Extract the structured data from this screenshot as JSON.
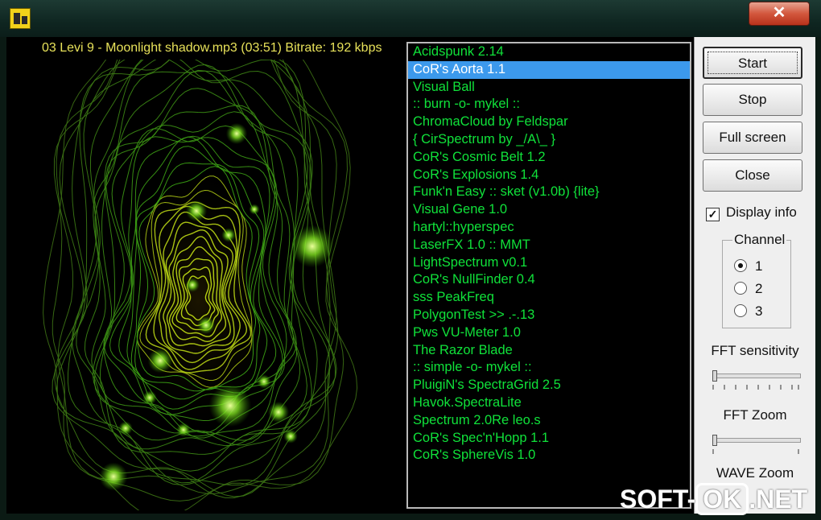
{
  "window": {
    "close_glyph": "✕"
  },
  "info_text": "03 Levi 9 - Moonlight shadow.mp3 (03:51) Bitrate: 192 kbps",
  "plugins": [
    {
      "label": "Acidspunk 2.14",
      "selected": false
    },
    {
      "label": "CoR's Aorta 1.1",
      "selected": true
    },
    {
      "label": "Visual Ball",
      "selected": false
    },
    {
      "label": ":: burn -o- mykel ::",
      "selected": false
    },
    {
      "label": "ChromaCloud by Feldspar",
      "selected": false
    },
    {
      "label": "{ CirSpectrum by _/A\\_ }",
      "selected": false
    },
    {
      "label": "CoR's Cosmic Belt 1.2",
      "selected": false
    },
    {
      "label": "CoR's Explosions 1.4",
      "selected": false
    },
    {
      "label": "Funk'n Easy :: sket (v1.0b) {lite}",
      "selected": false
    },
    {
      "label": "Visual Gene 1.0",
      "selected": false
    },
    {
      "label": "hartyl::hyperspec",
      "selected": false
    },
    {
      "label": "LaserFX 1.0 :: MMT",
      "selected": false
    },
    {
      "label": "LightSpectrum v0.1",
      "selected": false
    },
    {
      "label": "CoR's NullFinder 0.4",
      "selected": false
    },
    {
      "label": "sss PeakFreq",
      "selected": false
    },
    {
      "label": "PolygonTest >> .-.13",
      "selected": false
    },
    {
      "label": "Pws VU-Meter 1.0",
      "selected": false
    },
    {
      "label": "The Razor Blade",
      "selected": false
    },
    {
      "label": ":: simple -o- mykel ::",
      "selected": false
    },
    {
      "label": "PluigiN's SpectraGrid 2.5",
      "selected": false
    },
    {
      "label": "Havok.SpectraLite",
      "selected": false
    },
    {
      "label": "Spectrum 2.0Re leo.s",
      "selected": false
    },
    {
      "label": "CoR's Spec'n'Hopp 1.1",
      "selected": false
    },
    {
      "label": "CoR's SphereVis 1.0",
      "selected": false
    }
  ],
  "buttons": {
    "start": "Start",
    "stop": "Stop",
    "fullscreen": "Full screen",
    "close": "Close"
  },
  "display_info": {
    "label": "Display info",
    "checked": true,
    "check_glyph": "✓"
  },
  "channel": {
    "title": "Channel",
    "options": [
      "1",
      "2",
      "3"
    ],
    "selected": "1"
  },
  "sliders": {
    "fft_sensitivity": {
      "label": "FFT sensitivity",
      "value": 0.0
    },
    "fft_zoom": {
      "label": "FFT Zoom",
      "value": 0.0
    },
    "wave_zoom": {
      "label": "WAVE Zoom"
    }
  },
  "watermark": {
    "left": "SOFT-",
    "boxed": "OK",
    "right": ".NET"
  },
  "colors": {
    "list_text": "#10e23a",
    "selection": "#3c99ec",
    "info_text": "#e8e25a"
  }
}
